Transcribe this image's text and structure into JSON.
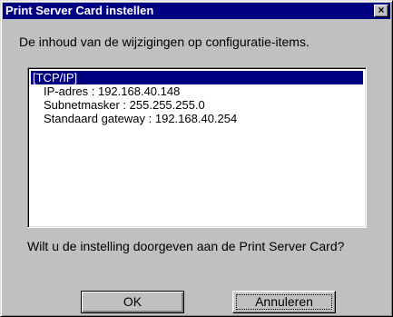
{
  "window": {
    "title": "Print Server Card instellen",
    "close_label": "×"
  },
  "description": "De inhoud van de wijzigingen op configuratie-items.",
  "list": {
    "items": [
      {
        "text": "[TCP/IP]",
        "selected": true
      },
      {
        "text": "IP-adres : 192.168.40.148",
        "selected": false
      },
      {
        "text": "Subnetmasker : 255.255.255.0",
        "selected": false
      },
      {
        "text": "Standaard gateway : 192.168.40.254",
        "selected": false
      }
    ]
  },
  "question": "Wilt u de instelling doorgeven aan de Print Server Card?",
  "buttons": {
    "ok_label": "OK",
    "cancel_label": "Annuleren"
  },
  "colors": {
    "title_bar": "#000080",
    "selection": "#000080",
    "face": "#c0c0c0"
  }
}
